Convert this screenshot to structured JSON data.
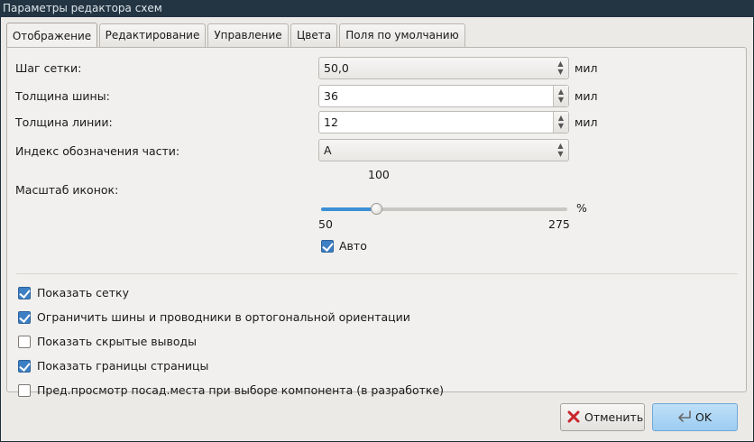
{
  "window": {
    "title": "Параметры редактора схем"
  },
  "tabs": [
    {
      "label": "Отображение",
      "active": true
    },
    {
      "label": "Редактирование",
      "active": false
    },
    {
      "label": "Управление",
      "active": false
    },
    {
      "label": "Цвета",
      "active": false
    },
    {
      "label": "Поля по умолчанию",
      "active": false
    }
  ],
  "fields": {
    "grid_size": {
      "label": "Шаг сетки:",
      "value": "50,0",
      "unit": "мил"
    },
    "bus_thickness": {
      "label": "Толщина шины:",
      "value": "36",
      "unit": "мил"
    },
    "line_thickness": {
      "label": "Толщина линии:",
      "value": "12",
      "unit": "мил"
    },
    "part_id": {
      "label": "Индекс обозначения части:",
      "value": "A"
    }
  },
  "icon_scale": {
    "label": "Масштаб иконок:",
    "value": 100,
    "value_label": "100",
    "min": 50,
    "min_label": "50",
    "max": 275,
    "max_label": "275",
    "unit": "%",
    "auto_label": "Авто",
    "auto_checked": true
  },
  "options": [
    {
      "label": "Показать сетку",
      "checked": true
    },
    {
      "label": "Ограничить шины и проводники в ортогональной ориентации",
      "checked": true
    },
    {
      "label": "Показать скрытые выводы",
      "checked": false
    },
    {
      "label": "Показать границы страницы",
      "checked": true
    },
    {
      "label": "Пред.просмотр посад.места при выборе компонента (в разработке)",
      "checked": false
    }
  ],
  "buttons": {
    "cancel_label": "Отменить",
    "ok_label": "OK"
  },
  "icons": {
    "cancel": "red-x-icon",
    "ok": "enter-arrow-icon",
    "spin": "up-down-arrows-icon"
  },
  "colors": {
    "accent": "#3d8fd6",
    "titlebar": "#233442",
    "window_bg": "#eceae7"
  }
}
